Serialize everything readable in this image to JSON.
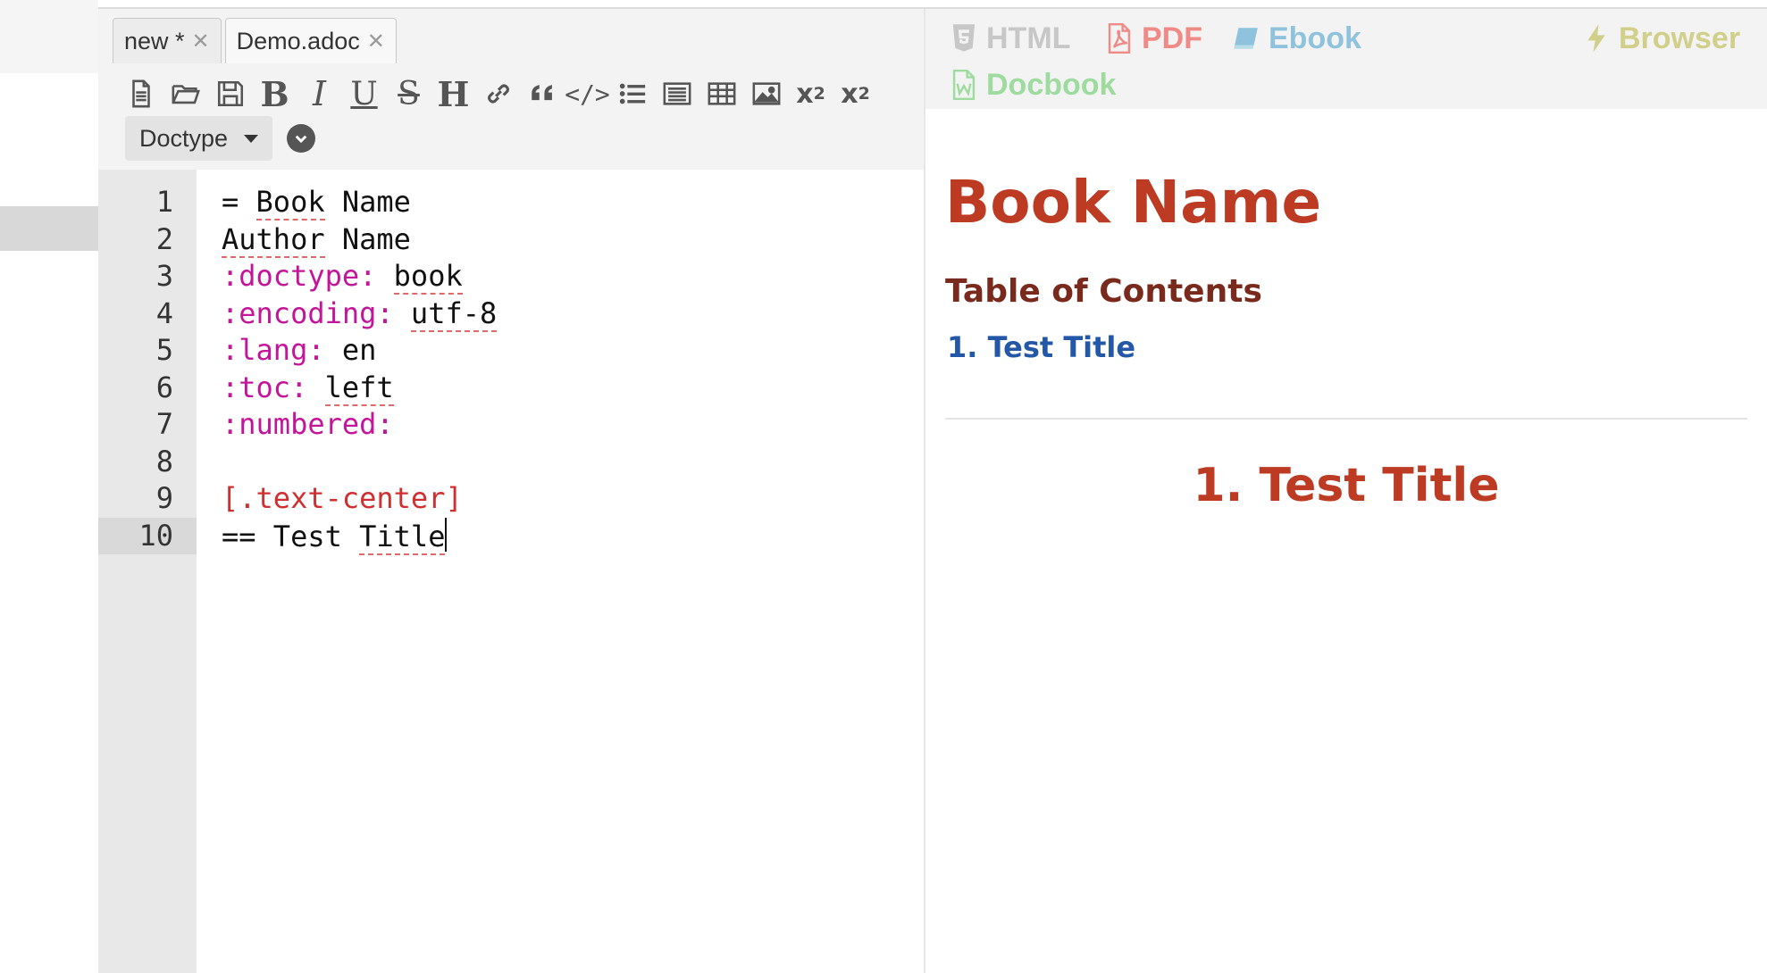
{
  "tabs": [
    {
      "label": "new *",
      "active": false
    },
    {
      "label": "Demo.adoc",
      "active": true
    }
  ],
  "toolbar": {
    "icons": [
      "new-file-icon",
      "open-folder-icon",
      "save-icon",
      "bold-icon",
      "italic-icon",
      "underline-icon",
      "strikethrough-icon",
      "heading-icon",
      "link-icon",
      "quote-icon",
      "code-icon",
      "bullet-list-icon",
      "numbered-list-icon",
      "table-icon",
      "image-icon",
      "subscript-icon",
      "superscript-icon"
    ],
    "bold": "B",
    "italic": "I",
    "underline": "U",
    "strike": "S",
    "heading": "H",
    "subscript": "x",
    "subscript_suffix": "2",
    "superscript": "x",
    "superscript_suffix": "2",
    "code": "</>"
  },
  "doctype": {
    "label": "Doctype"
  },
  "editor": {
    "active_line": 10,
    "line_numbers": [
      "1",
      "2",
      "3",
      "4",
      "5",
      "6",
      "7",
      "8",
      "9",
      "10"
    ],
    "lines": [
      {
        "parts": [
          {
            "t": "= ",
            "k": "plain"
          },
          {
            "t": "Book",
            "k": "sp"
          },
          {
            "t": " Name",
            "k": "plain"
          }
        ]
      },
      {
        "parts": [
          {
            "t": "Author",
            "k": "sp"
          },
          {
            "t": " Name",
            "k": "plain"
          }
        ]
      },
      {
        "parts": [
          {
            "t": ":doctype:",
            "k": "attr"
          },
          {
            "t": " ",
            "k": "plain"
          },
          {
            "t": "book",
            "k": "sp"
          }
        ]
      },
      {
        "parts": [
          {
            "t": ":encoding:",
            "k": "attr"
          },
          {
            "t": " ",
            "k": "plain"
          },
          {
            "t": "utf-8",
            "k": "sp"
          }
        ]
      },
      {
        "parts": [
          {
            "t": ":lang:",
            "k": "attr"
          },
          {
            "t": " en",
            "k": "plain"
          }
        ]
      },
      {
        "parts": [
          {
            "t": ":toc:",
            "k": "attr"
          },
          {
            "t": " ",
            "k": "plain"
          },
          {
            "t": "left",
            "k": "sp"
          }
        ]
      },
      {
        "parts": [
          {
            "t": ":numbered:",
            "k": "attr"
          }
        ]
      },
      {
        "parts": []
      },
      {
        "parts": [
          {
            "t": "[.text-center]",
            "k": "role"
          }
        ]
      },
      {
        "parts": [
          {
            "t": "== Test ",
            "k": "plain"
          },
          {
            "t": "Title",
            "k": "sp"
          }
        ]
      }
    ]
  },
  "export": {
    "html": "HTML",
    "pdf": "PDF",
    "ebook": "Ebook",
    "browser": "Browser",
    "docbook": "Docbook"
  },
  "colors": {
    "html": "#c7c7c7",
    "pdf": "#f08a86",
    "ebook": "#8fc3dd",
    "browser": "#d1cf8a",
    "docbook": "#9edb9f",
    "title": "#bd3a23",
    "toc_title": "#7a2a1c",
    "toc_link": "#2358a8"
  },
  "preview": {
    "title": "Book Name",
    "toc_title": "Table of Contents",
    "toc_items": [
      "1. Test Title"
    ],
    "section_title": "1. Test Title"
  }
}
